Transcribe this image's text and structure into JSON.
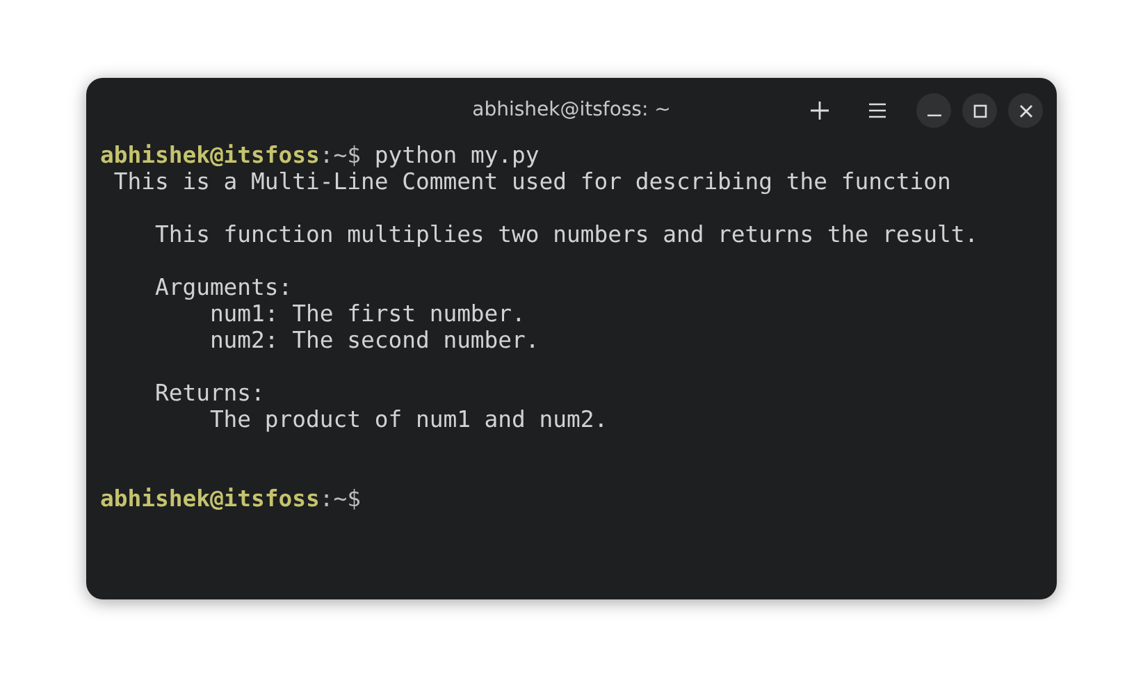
{
  "window": {
    "title": "abhishek@itsfoss: ~"
  },
  "terminal": {
    "lines": [
      {
        "kind": "prompt",
        "user_host": "abhishek@itsfoss",
        "path": ":~$",
        "command": "python my.py"
      },
      {
        "kind": "output",
        "text": " This is a Multi-Line Comment used for describing the function"
      },
      {
        "kind": "blank"
      },
      {
        "kind": "output",
        "text": "    This function multiplies two numbers and returns the result."
      },
      {
        "kind": "blank"
      },
      {
        "kind": "output",
        "text": "    Arguments:"
      },
      {
        "kind": "output",
        "text": "        num1: The first number."
      },
      {
        "kind": "output",
        "text": "        num2: The second number."
      },
      {
        "kind": "blank"
      },
      {
        "kind": "output",
        "text": "    Returns:"
      },
      {
        "kind": "output",
        "text": "        The product of num1 and num2."
      },
      {
        "kind": "blank"
      },
      {
        "kind": "blank"
      },
      {
        "kind": "prompt",
        "user_host": "abhishek@itsfoss",
        "path": ":~$"
      }
    ]
  }
}
